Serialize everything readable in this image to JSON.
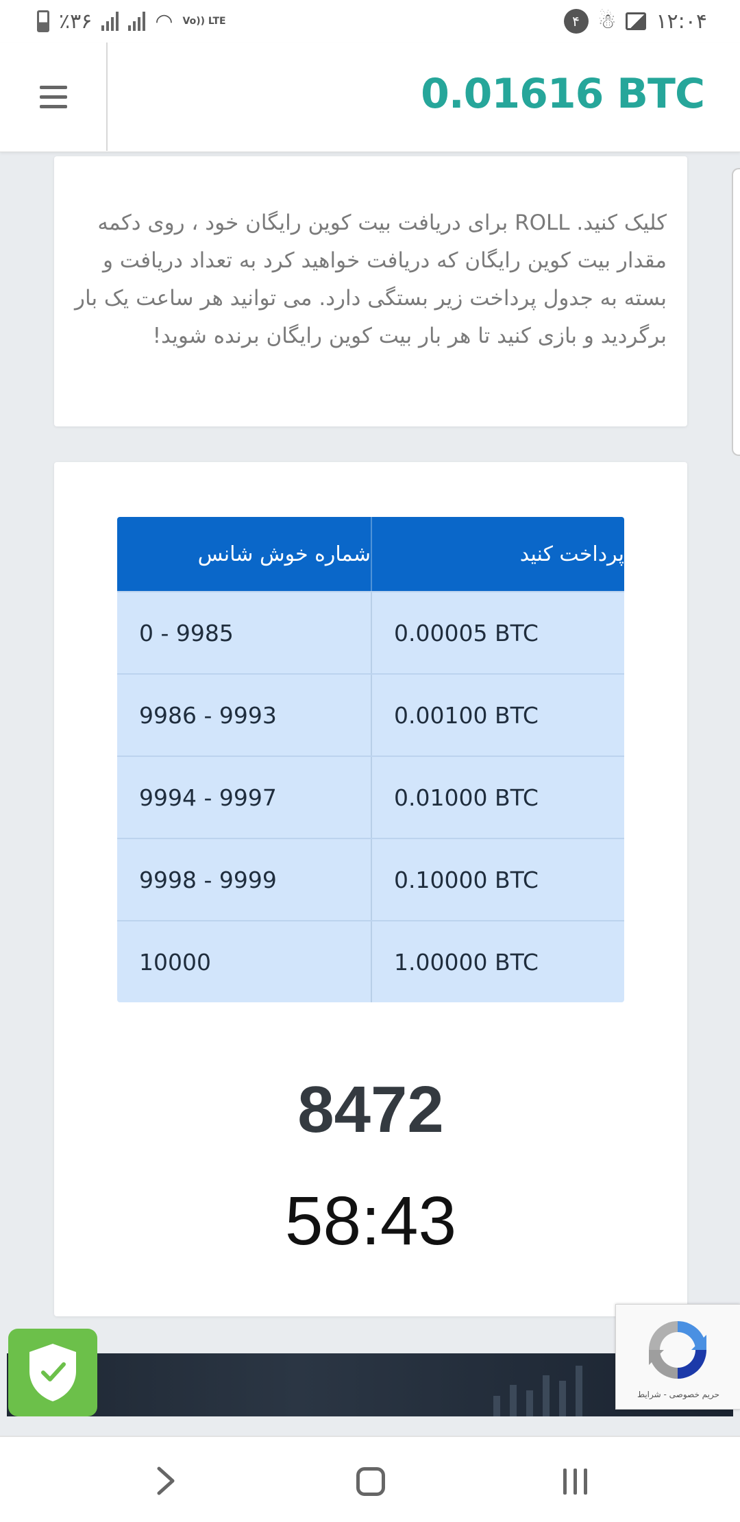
{
  "status_bar": {
    "battery": "٪۳۶",
    "network": "Vo)) LTE",
    "notification_count": "۴",
    "time": "۱۲:۰۴"
  },
  "header": {
    "balance": "0.01616 BTC"
  },
  "info": {
    "text": "کلیک کنید. ROLL برای دریافت بیت کوین رایگان خود ، روی دکمه مقدار بیت کوین رایگان که دریافت خواهید کرد به تعداد دریافت و بسته به جدول پرداخت زیر بستگی دارد. می توانید هر ساعت یک بار برگردید و بازی کنید تا هر بار بیت کوین رایگان برنده شوید!"
  },
  "payout_table": {
    "headers": [
      "شماره خوش شانس",
      "پرداخت کنید"
    ],
    "rows": [
      [
        "0 - 9985",
        "0.00005 BTC"
      ],
      [
        "9986 - 9993",
        "0.00100 BTC"
      ],
      [
        "9994 - 9997",
        "0.01000 BTC"
      ],
      [
        "9998 - 9999",
        "0.10000 BTC"
      ],
      [
        "10000",
        "1.00000 BTC"
      ]
    ]
  },
  "roll": {
    "number": "8472",
    "countdown": "58:43"
  },
  "recaptcha": {
    "links": "حریم خصوصی - شرایط"
  },
  "colors": {
    "accent": "#26a69a",
    "table_header": "#0a67c9",
    "table_row": "#d2e5fb",
    "shield": "#6cc04a"
  }
}
